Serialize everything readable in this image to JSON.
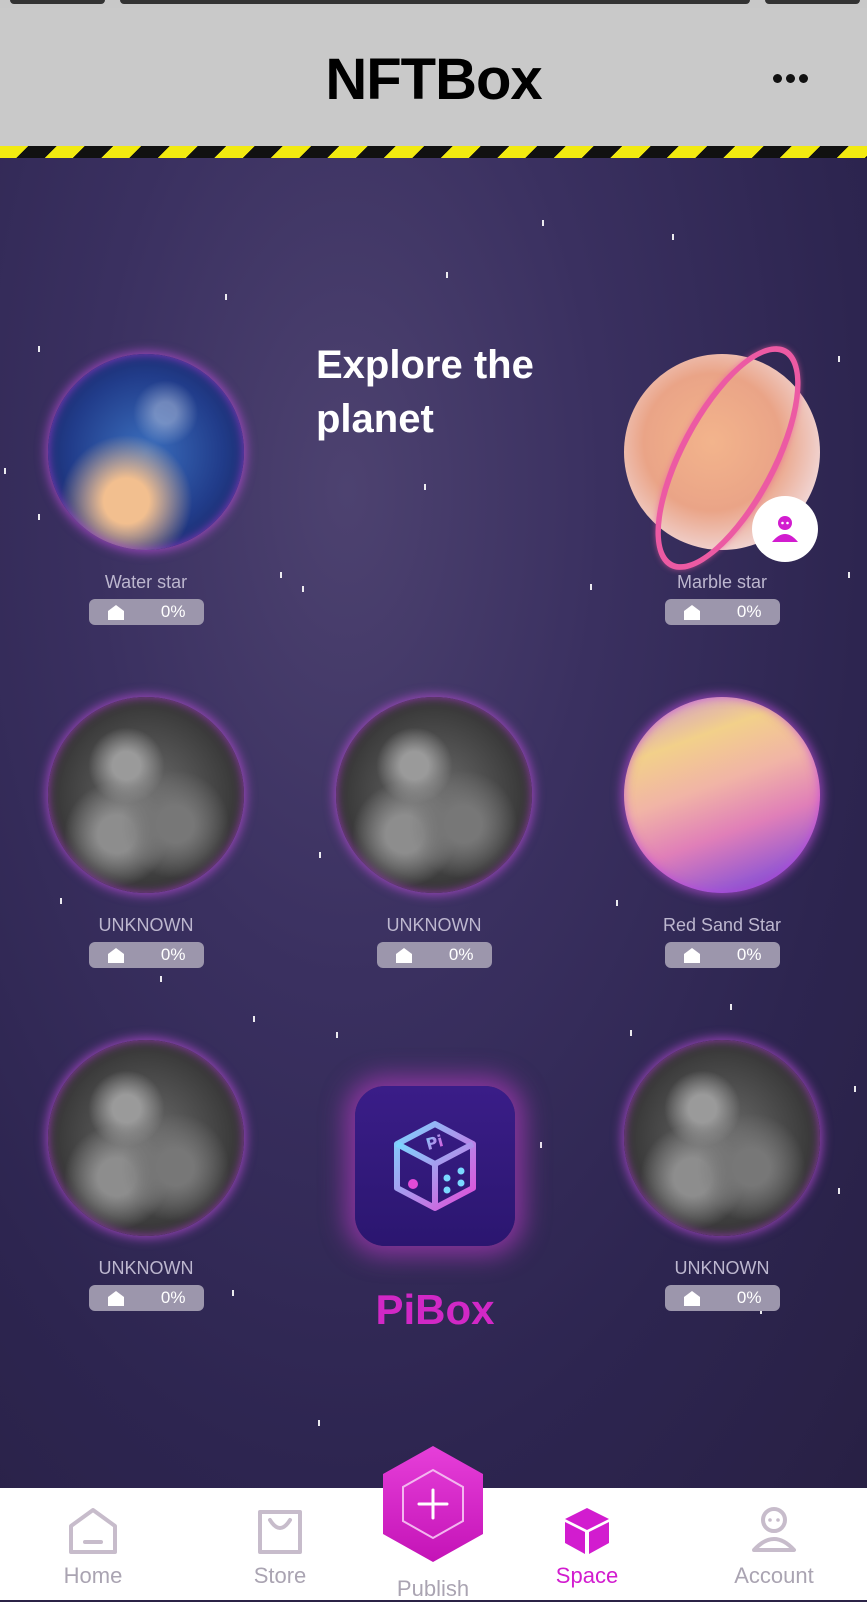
{
  "header": {
    "title": "NFTBox",
    "more_icon": "more-dots-icon"
  },
  "main": {
    "headline": "Explore the planet",
    "planets": [
      {
        "name": "Water star",
        "progress": "0%",
        "progress_value": 0,
        "kind": "water"
      },
      {
        "name": "Marble star",
        "progress": "0%",
        "progress_value": 0,
        "kind": "marble",
        "owner_badge": "user-icon"
      },
      {
        "name": "UNKNOWN",
        "progress": "0%",
        "progress_value": 0,
        "kind": "unknown"
      },
      {
        "name": "UNKNOWN",
        "progress": "0%",
        "progress_value": 0,
        "kind": "unknown"
      },
      {
        "name": "Red Sand Star",
        "progress": "0%",
        "progress_value": 0,
        "kind": "redsand"
      },
      {
        "name": "UNKNOWN",
        "progress": "0%",
        "progress_value": 0,
        "kind": "unknown"
      },
      {
        "name": "UNKNOWN",
        "progress": "0%",
        "progress_value": 0,
        "kind": "unknown"
      }
    ],
    "pibox": {
      "label": "PiBox",
      "icon": "dice-icon"
    }
  },
  "nav": {
    "items": [
      {
        "label": "Home",
        "icon": "home-icon"
      },
      {
        "label": "Store",
        "icon": "shopping-bag-icon"
      },
      {
        "label": "Publish",
        "icon": "plus-hexagon-icon"
      },
      {
        "label": "Space",
        "icon": "cube-icon",
        "active": true
      },
      {
        "label": "Account",
        "icon": "user-icon"
      }
    ]
  },
  "colors": {
    "accent": "#d21ccf",
    "header_bg": "#c9c9c9",
    "space_bg": "#2b2346",
    "hazard_yellow": "#f2ea10"
  }
}
